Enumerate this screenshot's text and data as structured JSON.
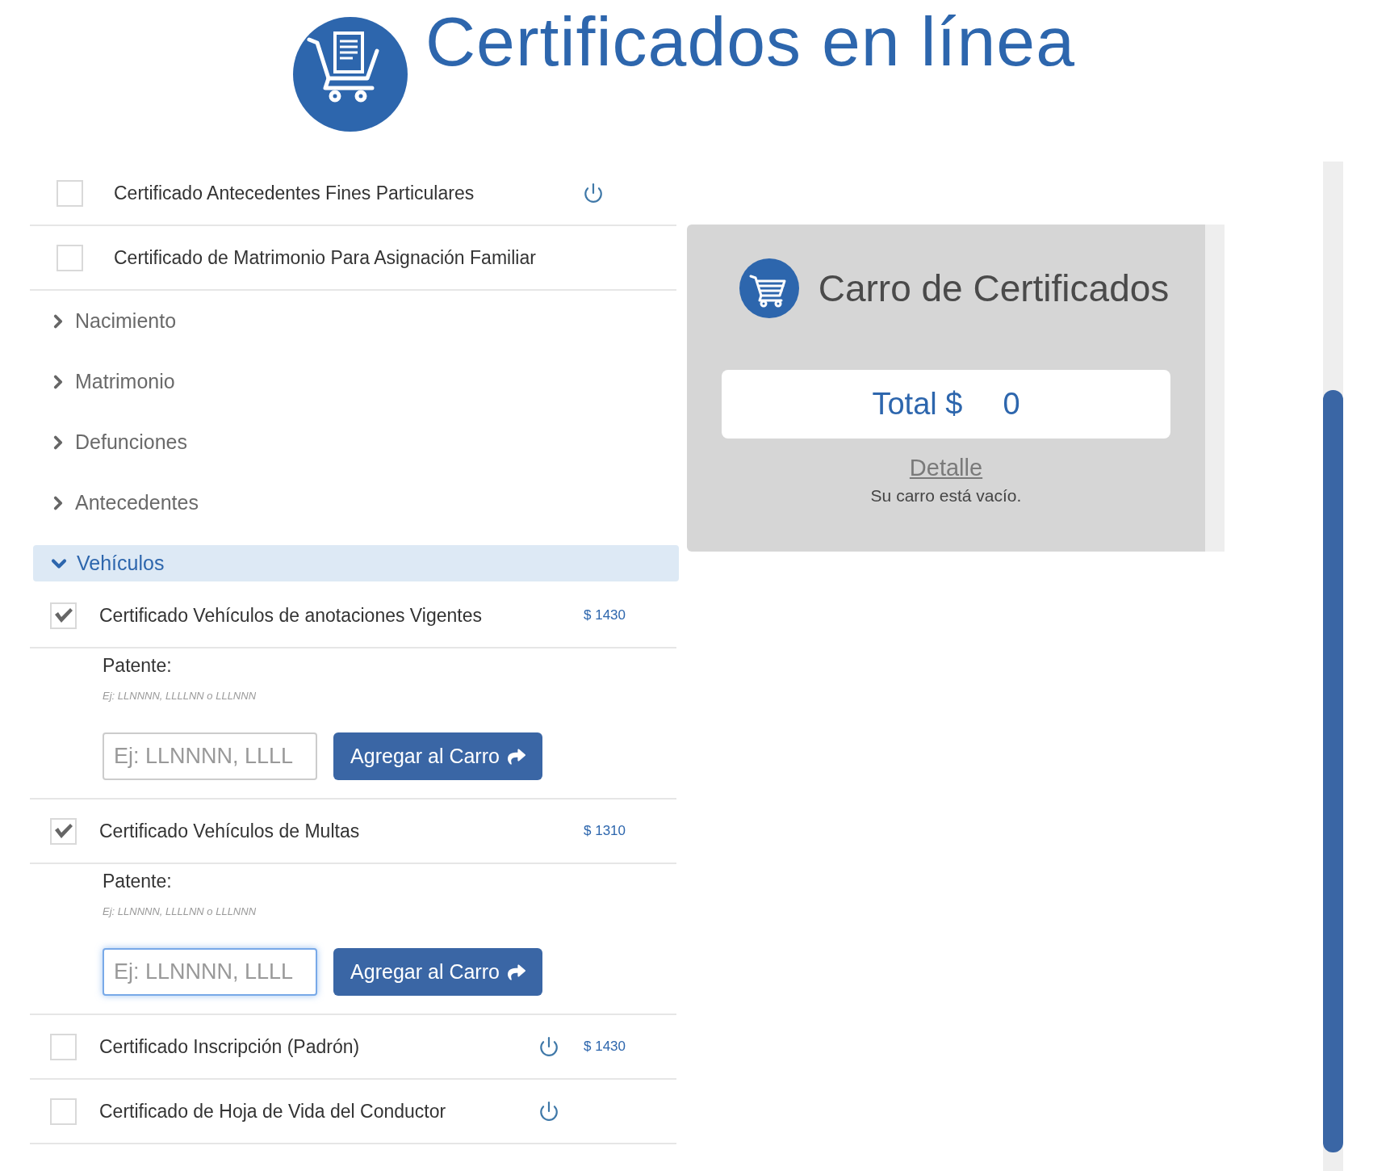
{
  "header": {
    "title": "Certificados en línea"
  },
  "certificates": [
    {
      "label": "Certificado Antecedentes Fines Particulares",
      "checked": false,
      "power_icon": true
    },
    {
      "label": "Certificado de Matrimonio Para Asignación Familiar",
      "checked": false,
      "power_icon": false
    }
  ],
  "categories": [
    {
      "label": "Nacimiento",
      "expanded": false
    },
    {
      "label": "Matrimonio",
      "expanded": false
    },
    {
      "label": "Defunciones",
      "expanded": false
    },
    {
      "label": "Antecedentes",
      "expanded": false
    },
    {
      "label": "Vehículos",
      "expanded": true,
      "items": [
        {
          "label": "Certificado Vehículos de anotaciones Vigentes",
          "checked": true,
          "power_icon": false,
          "price": "$ 1430",
          "form": {
            "label": "Patente:",
            "hint": "Ej: LLNNNN, LLLLNN o LLLNNN",
            "placeholder": "Ej: LLNNNN, LLLL",
            "focused": false,
            "button": "Agregar al Carro"
          }
        },
        {
          "label": "Certificado Vehículos de Multas",
          "checked": true,
          "power_icon": false,
          "price": "$ 1310",
          "form": {
            "label": "Patente:",
            "hint": "Ej: LLNNNN, LLLLNN o LLLNNN",
            "placeholder": "Ej: LLNNNN, LLLL",
            "focused": true,
            "button": "Agregar al Carro"
          }
        },
        {
          "label": "Certificado Inscripción (Padrón)",
          "checked": false,
          "power_icon": true,
          "price": "$ 1430"
        },
        {
          "label": "Certificado de Hoja de Vida del Conductor",
          "checked": false,
          "power_icon": true
        }
      ]
    }
  ],
  "cart": {
    "title": "Carro de Certificados",
    "total_label": "Total $",
    "total_value": "0",
    "detail_link": "Detalle",
    "empty_message": "Su carro está vacío."
  }
}
